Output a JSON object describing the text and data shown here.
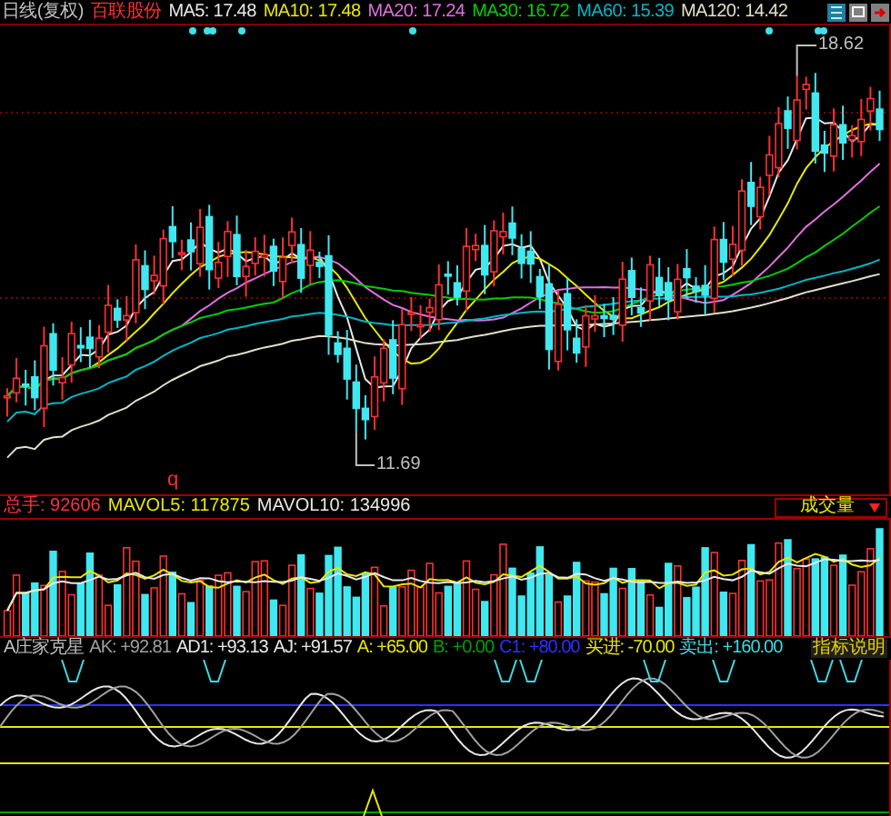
{
  "title": {
    "period": "日线(复权)",
    "stock": "百联股份"
  },
  "ma_legend": [
    {
      "label": "MA5: 17.48",
      "color": "#e8e8e8"
    },
    {
      "label": "MA10: 17.48",
      "color": "#e8e800"
    },
    {
      "label": "MA20: 17.24",
      "color": "#e070e0"
    },
    {
      "label": "MA30: 16.72",
      "color": "#00d000"
    },
    {
      "label": "MA60: 15.39",
      "color": "#00b8c8"
    },
    {
      "label": "MA120: 14.42",
      "color": "#e0e0c8"
    }
  ],
  "price_labels": {
    "high": "18.62",
    "low": "11.69"
  },
  "marker": "q",
  "volume": {
    "legend": [
      {
        "label": "总手: 92606",
        "color": "#ff3040"
      },
      {
        "label": "MAVOL5: 117875",
        "color": "#e8e800"
      },
      {
        "label": "MAVOL10: 134996",
        "color": "#e8e8e8"
      }
    ],
    "selector": "成交量"
  },
  "indicator": {
    "name": "A庄家克星",
    "legend": [
      {
        "label": "AK: +92.81",
        "color": "#a0a0a0"
      },
      {
        "label": "AD1: +93.13",
        "color": "#e8e8e8"
      },
      {
        "label": "AJ: +91.57",
        "color": "#e8e8e8"
      },
      {
        "label": "A: +65.00",
        "color": "#e8e800"
      },
      {
        "label": "B: +0.00",
        "color": "#00a000"
      },
      {
        "label": "C1: +80.00",
        "color": "#3030ff"
      },
      {
        "label": "买进: -70.00",
        "color": "#e8e800"
      },
      {
        "label": "卖出: +160.00",
        "color": "#40d8e0"
      }
    ],
    "help_button": "指标说明"
  }
}
